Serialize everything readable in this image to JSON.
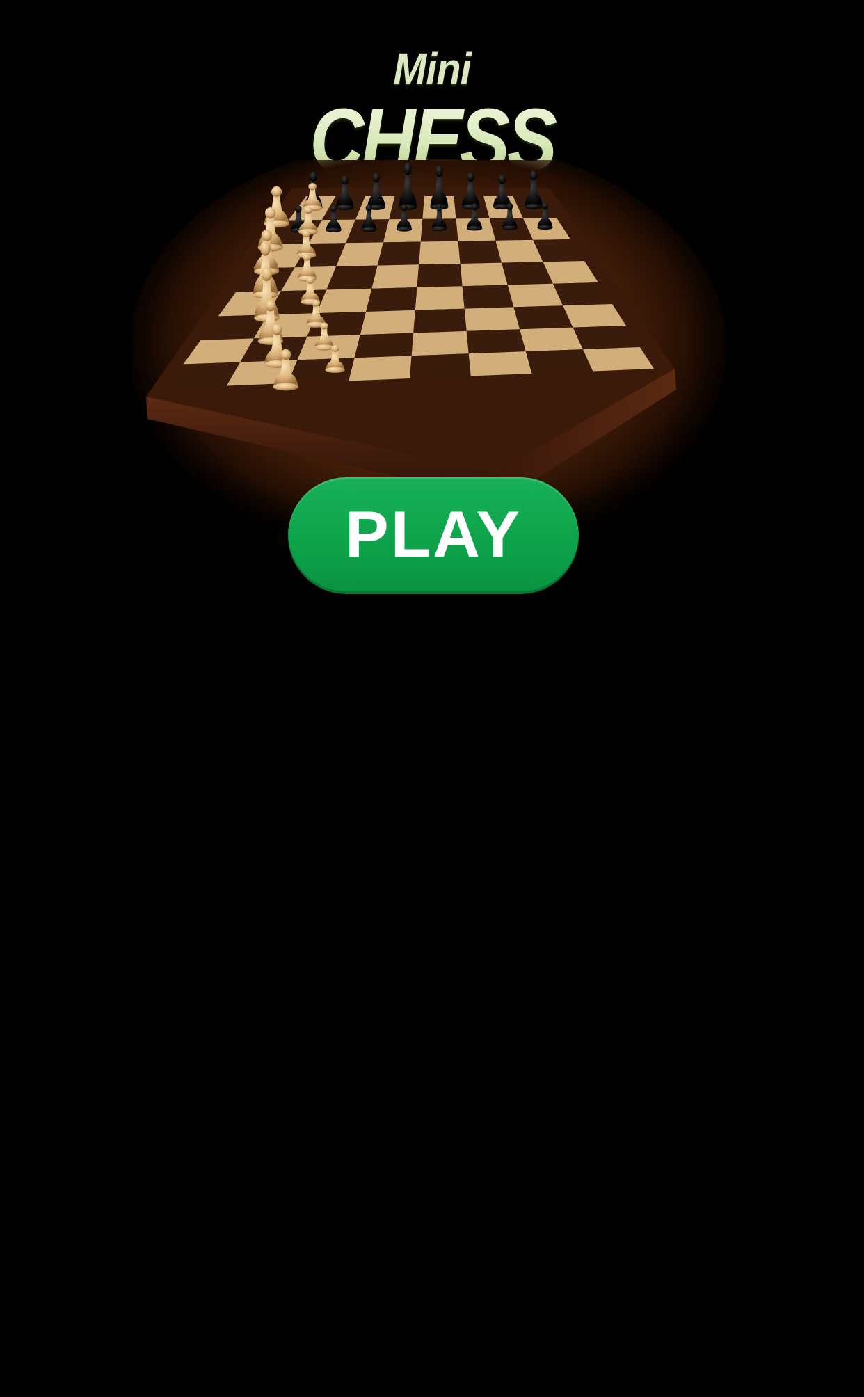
{
  "title": {
    "line1": "Mini",
    "line2": "CHESS"
  },
  "hero": {
    "icon": "chess-board-illustration",
    "board_light": "#d2ae7a",
    "board_dark": "#3a1c0c",
    "frame": "#4a230f"
  },
  "play_button": {
    "label": "PLAY",
    "color": "#0ea34b"
  }
}
